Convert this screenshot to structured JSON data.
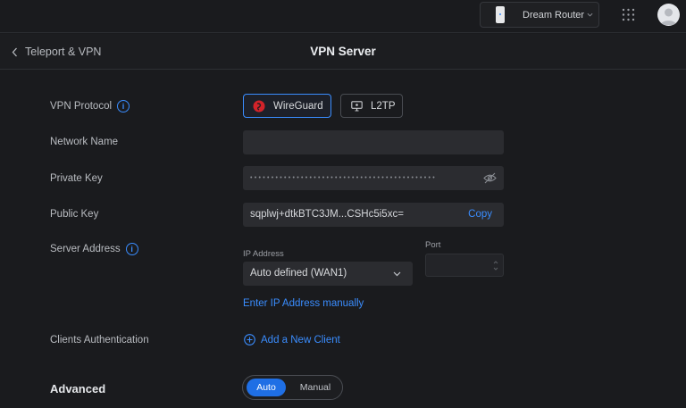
{
  "topbar": {
    "device_name": "Dream Router"
  },
  "header": {
    "back_label": "Teleport & VPN",
    "title": "VPN Server"
  },
  "form": {
    "vpn_protocol": {
      "label": "VPN Protocol",
      "options": [
        {
          "label": "WireGuard",
          "selected": true
        },
        {
          "label": "L2TP",
          "selected": false
        }
      ]
    },
    "network_name": {
      "label": "Network Name",
      "value": ""
    },
    "private_key": {
      "label": "Private Key",
      "masked": "••••••••••••••••••••••••••••••••••••••••••••"
    },
    "public_key": {
      "label": "Public Key",
      "value": "sqplwj+dtkBTC3JM...CSHc5i5xc=",
      "copy_label": "Copy"
    },
    "server_address": {
      "label": "Server Address",
      "ip_label": "IP Address",
      "ip_value": "Auto defined (WAN1)",
      "port_label": "Port",
      "port_value": "",
      "manual_link": "Enter IP Address manually"
    },
    "clients_auth": {
      "label": "Clients Authentication",
      "add_label": "Add a New Client"
    },
    "advanced": {
      "label": "Advanced",
      "options": [
        {
          "label": "Auto",
          "selected": true
        },
        {
          "label": "Manual",
          "selected": false
        }
      ]
    }
  },
  "colors": {
    "accent": "#3a8dff",
    "background": "#1a1b1e",
    "field": "#2b2c30",
    "wireguard_brand": "#d2232a"
  }
}
